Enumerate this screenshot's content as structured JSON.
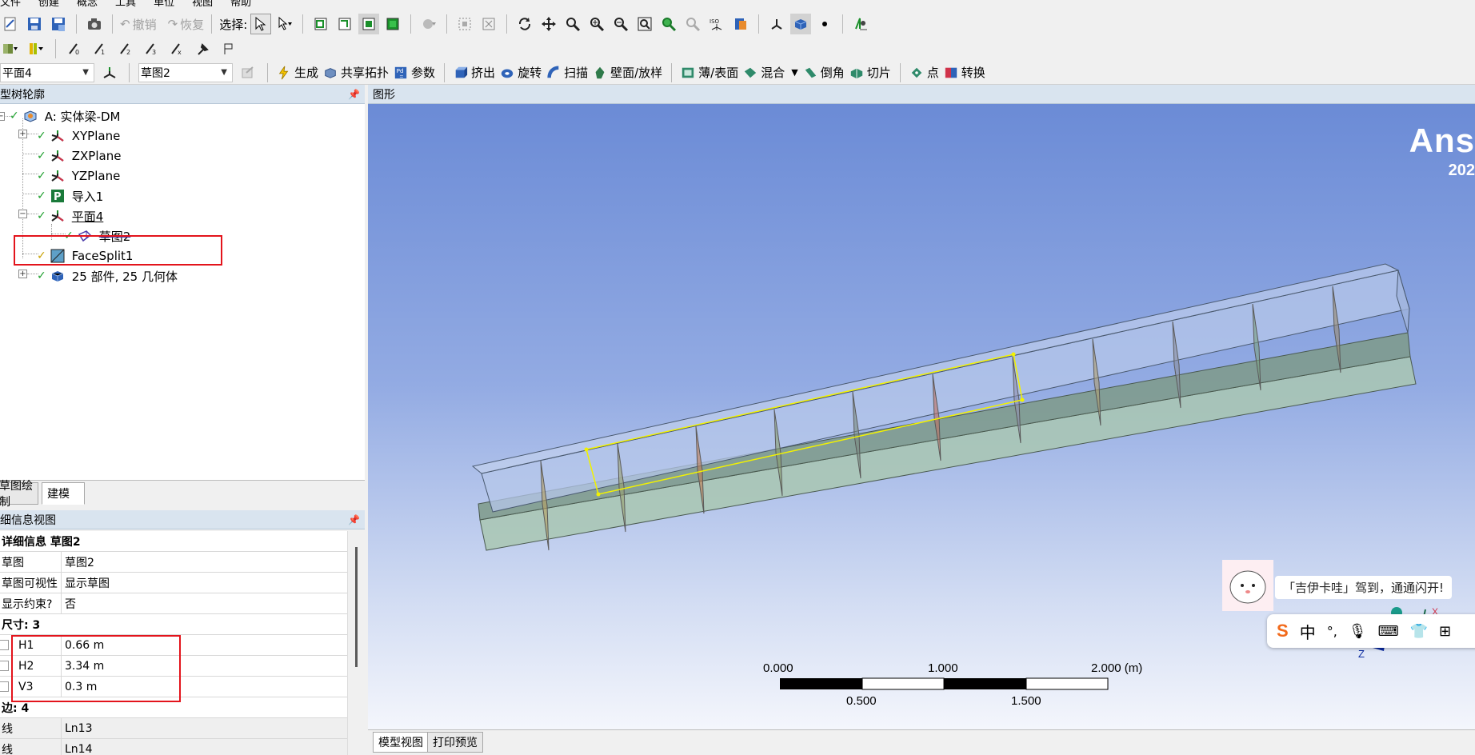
{
  "menubar": [
    "文件",
    "创建",
    "概念",
    "工具",
    "单位",
    "视图",
    "帮助"
  ],
  "toolbar1": {
    "undo_label": "撤销",
    "redo_label": "恢复",
    "select_label": "选择:"
  },
  "toolbar3": {
    "plane_combo": "平面4",
    "sketch_combo": "草图2",
    "generate": "生成",
    "share_topology": "共享拓扑",
    "parameters": "参数",
    "extrude": "挤出",
    "revolve": "旋转",
    "sweep": "扫描",
    "skin_loft": "壁面/放样",
    "thin_surface": "薄/表面",
    "blend": "混合",
    "chamfer": "倒角",
    "slice": "切片",
    "point": "点",
    "conversion": "转换"
  },
  "tree_panel": {
    "title": "型树轮廓",
    "nodes": [
      {
        "label": "A: 实体梁-DM"
      },
      {
        "label": "XYPlane"
      },
      {
        "label": "ZXPlane"
      },
      {
        "label": "YZPlane"
      },
      {
        "label": "导入1"
      },
      {
        "label": "平面4"
      },
      {
        "label": "草图2"
      },
      {
        "label": "FaceSplit1"
      },
      {
        "label": "25 部件, 25 几何体"
      }
    ]
  },
  "mode_tabs": [
    "草图绘制",
    "建模"
  ],
  "details_panel": {
    "title": "细信息视图",
    "header": "详细信息 草图2",
    "rows": [
      {
        "k": "草图",
        "v": "草图2"
      },
      {
        "k": "草图可视性",
        "v": "显示草图"
      },
      {
        "k": "显示约束?",
        "v": "否"
      }
    ],
    "dim_section": "尺寸: 3",
    "dims": [
      {
        "k": "H1",
        "v": "0.66 m"
      },
      {
        "k": "H2",
        "v": "3.34 m"
      },
      {
        "k": "V3",
        "v": "0.3 m"
      }
    ],
    "edge_section": "边: 4",
    "edges": [
      {
        "k": "线",
        "v": "Ln13"
      },
      {
        "k": "线",
        "v": "Ln14"
      }
    ]
  },
  "graphics": {
    "title": "图形",
    "brand": "Ans",
    "brand_version": "202",
    "scale": {
      "top_labels": [
        "0.000",
        "1.000",
        "2.000 (m)"
      ],
      "bottom_labels": [
        "0.500",
        "1.500"
      ]
    },
    "triad_x": "X",
    "triad_z": "Z"
  },
  "view_tabs": [
    "模型视图",
    "打印预览"
  ],
  "toast": {
    "text": "「吉伊卡哇」驾到，通通闪开!"
  },
  "ime": {
    "lang": "中"
  },
  "colors": {
    "viewport_top": "#6b8bd6",
    "viewport_bottom": "#f4f6fc",
    "highlight_box": "#e3141c",
    "sketch_line": "#f2f200",
    "check": "#1b9e2b"
  }
}
